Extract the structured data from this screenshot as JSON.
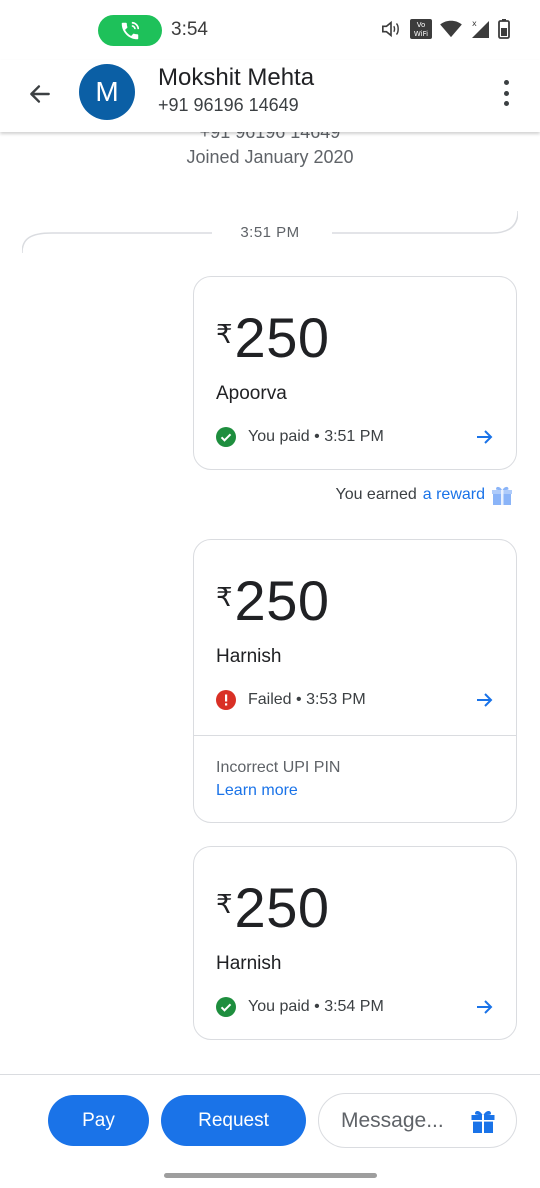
{
  "status_bar": {
    "time": "3:54",
    "vowifi_label": "Vo\nWiFi"
  },
  "header": {
    "avatar_letter": "M",
    "name": "Mokshit Mehta",
    "phone": "+91 96196 14649"
  },
  "conversation": {
    "cut_phone": "+91 96196 14649",
    "joined": "Joined January 2020",
    "time_separator": "3:51 PM"
  },
  "transactions": [
    {
      "currency": "₹",
      "amount": "250",
      "recipient": "Apoorva",
      "status_text": "You paid • 3:51 PM",
      "status": "success"
    },
    {
      "currency": "₹",
      "amount": "250",
      "recipient": "Harnish",
      "status_text": "Failed • 3:53 PM",
      "status": "failed",
      "reason": "Incorrect UPI PIN",
      "learn_more": "Learn more"
    },
    {
      "currency": "₹",
      "amount": "250",
      "recipient": "Harnish",
      "status_text": "You paid • 3:54 PM",
      "status": "success"
    }
  ],
  "reward": {
    "prefix": "You earned",
    "link": "a reward"
  },
  "bottom": {
    "pay_label": "Pay",
    "request_label": "Request",
    "message_placeholder": "Message..."
  },
  "colors": {
    "primary": "#1a73e8",
    "success": "#1e8e3e",
    "error": "#d93025",
    "avatar": "#0b5fa5",
    "call": "#1ec15a"
  }
}
